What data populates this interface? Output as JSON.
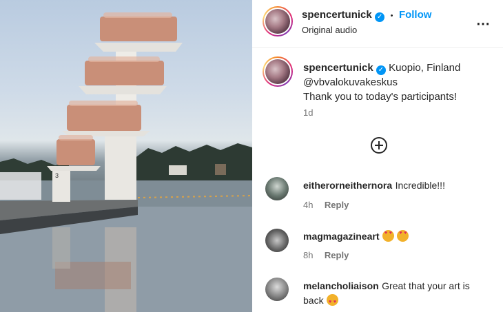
{
  "post": {
    "author": "spencertunick",
    "follow_label": "Follow",
    "separator": "•",
    "audio": "Original audio",
    "more": "⋯"
  },
  "caption": {
    "author": "spencertunick",
    "location": "Kuopio, Finland",
    "mention": "@vbvalokuvakeskus",
    "text": "Thank you to today's participants!",
    "age": "1d"
  },
  "comments": [
    {
      "user": "eitherorneithernora",
      "text": "Incredible!!!",
      "age": "4h",
      "reply": "Reply"
    },
    {
      "user": "magmagazineart",
      "text": "",
      "age": "8h",
      "reply": "Reply"
    },
    {
      "user": "melancholiaison",
      "text": "Great that your art is",
      "text2": "back",
      "age": "",
      "reply": ""
    }
  ],
  "media": {
    "tower_number": "3"
  },
  "colors": {
    "accent": "#0095f6",
    "verified": "#0095f6"
  }
}
